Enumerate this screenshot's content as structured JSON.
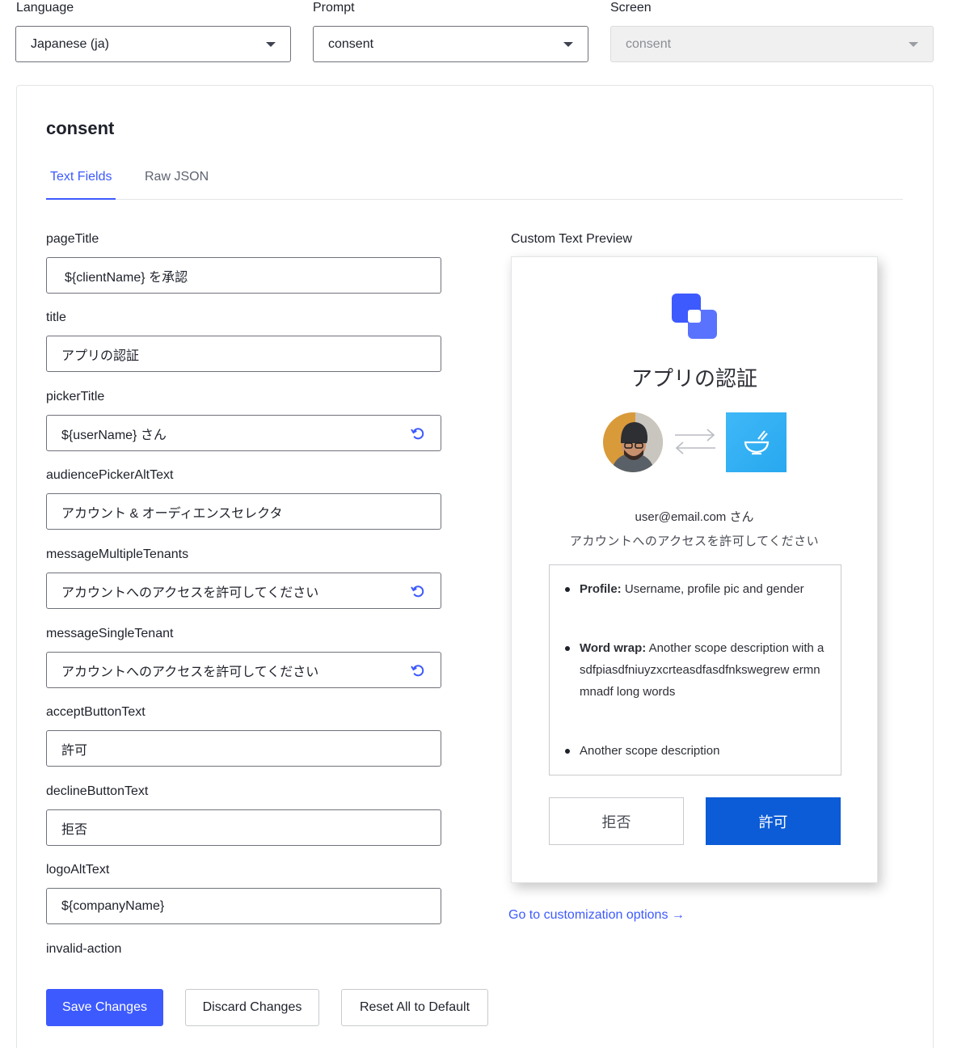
{
  "selectors": {
    "language": {
      "label": "Language",
      "value": "Japanese (ja)"
    },
    "prompt": {
      "label": "Prompt",
      "value": "consent"
    },
    "screen": {
      "label": "Screen",
      "value": "consent"
    }
  },
  "card": {
    "title": "consent",
    "tabs": [
      {
        "label": "Text Fields",
        "active": true
      },
      {
        "label": "Raw JSON",
        "active": false
      }
    ]
  },
  "fields": [
    {
      "label": "pageTitle",
      "value": "${clientName} を承認",
      "reset": false
    },
    {
      "label": "title",
      "value": "アプリの認証",
      "reset": false
    },
    {
      "label": "pickerTitle",
      "value": "${userName} さん",
      "reset": true
    },
    {
      "label": "audiencePickerAltText",
      "value": "アカウント & オーディエンスセレクタ",
      "reset": false
    },
    {
      "label": "messageMultipleTenants",
      "value": "アカウントへのアクセスを許可してください",
      "reset": true
    },
    {
      "label": "messageSingleTenant",
      "value": "アカウントへのアクセスを許可してください",
      "reset": true
    },
    {
      "label": "acceptButtonText",
      "value": "許可",
      "reset": false
    },
    {
      "label": "declineButtonText",
      "value": "拒否",
      "reset": false
    },
    {
      "label": "logoAltText",
      "value": "${companyName}",
      "reset": false
    }
  ],
  "extra_label": "invalid-action",
  "actions": {
    "save": "Save Changes",
    "discard": "Discard Changes",
    "reset_all": "Reset All to Default"
  },
  "preview": {
    "label": "Custom Text Preview",
    "title": "アプリの認証",
    "user": "user@email.com さん",
    "message": "アカウントへのアクセスを許可してください",
    "scopes": [
      {
        "name": "Profile:",
        "desc": "Username, profile pic and gender"
      },
      {
        "name": "Word wrap:",
        "desc": "Another scope description with asdfpiasdfniuyzxcrteasdfasdfnkswegrew ermnmnadf long words"
      },
      {
        "name": "",
        "desc": "Another scope description"
      }
    ],
    "decline": "拒否",
    "accept": "許可"
  },
  "customization_link": "Go to customization options →",
  "colors": {
    "accent": "#3d5afe",
    "preview_accept": "#0b5cd6",
    "app_icon": "#3fb8f7"
  },
  "icons": [
    "chevron-down-icon",
    "reset-icon",
    "app-logo-icon",
    "arrows-exchange-icon",
    "bowl-icon"
  ]
}
